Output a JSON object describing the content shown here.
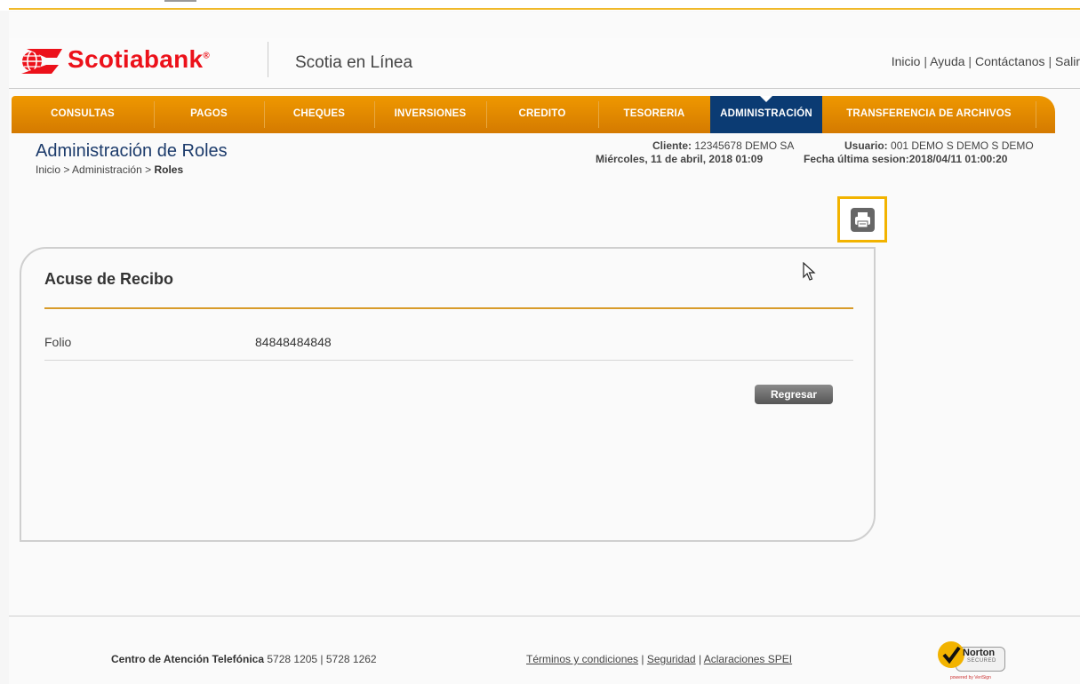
{
  "brand": {
    "name": "Scotiabank",
    "trademark": "®",
    "product": "Scotia en Línea",
    "color": "#ec111a"
  },
  "top_links": [
    "Inicio",
    "Ayuda",
    "Contáctanos",
    "Salir"
  ],
  "nav": {
    "items": [
      "CONSULTAS",
      "PAGOS",
      "CHEQUES",
      "INVERSIONES",
      "CREDITO",
      "TESORERIA",
      "ADMINISTRACIÓN",
      "TRANSFERENCIA DE ARCHIVOS"
    ],
    "active": "ADMINISTRACIÓN",
    "color": "#e58c00",
    "active_color": "#0b3b73"
  },
  "page": {
    "title": "Administración de Roles",
    "breadcrumb": {
      "home": "Inicio",
      "section": "Administración",
      "current": "Roles",
      "separator": ">"
    }
  },
  "session": {
    "client_label": "Cliente:",
    "client_value": "12345678  DEMO SA",
    "user_label": "Usuario:",
    "user_value": "001 DEMO S DEMO S DEMO",
    "date": "Miércoles, 11 de abril, 2018 01:09",
    "last_session_label": "Fecha última sesion:",
    "last_session_value": "2018/04/11 01:00:20"
  },
  "print_button": {
    "icon": "printer-icon",
    "highlight_color": "#f2b300"
  },
  "receipt": {
    "title": "Acuse de Recibo",
    "folio_label": "Folio",
    "folio_value": "84848484848",
    "back_button": "Regresar"
  },
  "footer": {
    "call_center_label": "Centro de Atención Telefónica",
    "phones": "5728 1205 | 5728 1262",
    "links": [
      "Términos y condiciones",
      "Seguridad",
      "Aclaraciones SPEI"
    ],
    "norton": {
      "name": "Norton",
      "sub": "SECURED",
      "powered": "powered by VeriSign"
    }
  }
}
